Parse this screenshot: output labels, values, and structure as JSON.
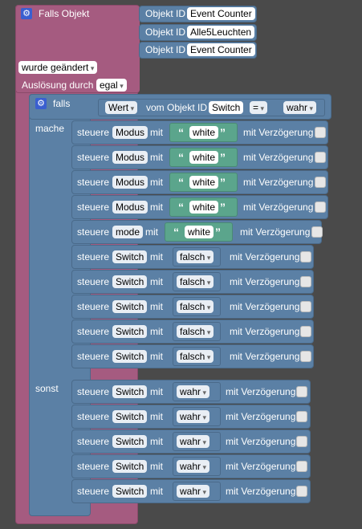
{
  "trigger": {
    "title": "Falls Objekt",
    "objects": [
      {
        "label": "Objekt ID",
        "value": "Event Counter"
      },
      {
        "label": "Objekt ID",
        "value": "Alle5Leuchten"
      },
      {
        "label": "Objekt ID",
        "value": "Event Counter"
      }
    ],
    "condition_value": "wurde geändert",
    "trigger_label": "Auslösung durch",
    "trigger_value": "egal"
  },
  "if_block": {
    "falls_label": "falls",
    "mache_label": "mache",
    "sonst_label": "sonst",
    "cond": {
      "attr": "Wert",
      "of_label": "vom Objekt ID",
      "obj": "Switch",
      "op": "=",
      "value": "wahr"
    }
  },
  "mache_rows": [
    {
      "steuere": "steuere",
      "target": "Modus",
      "mit": "mit",
      "value": "white",
      "delay": "mit Verzögerung"
    },
    {
      "steuere": "steuere",
      "target": "Modus",
      "mit": "mit",
      "value": "white",
      "delay": "mit Verzögerung"
    },
    {
      "steuere": "steuere",
      "target": "Modus",
      "mit": "mit",
      "value": "white",
      "delay": "mit Verzögerung"
    },
    {
      "steuere": "steuere",
      "target": "Modus",
      "mit": "mit",
      "value": "white",
      "delay": "mit Verzögerung"
    },
    {
      "steuere": "steuere",
      "target": "mode",
      "mit": "mit",
      "value": "white",
      "delay": "mit Verzögerung"
    },
    {
      "steuere": "steuere",
      "target": "Switch",
      "mit": "mit",
      "value": "falsch",
      "delay": "mit Verzögerung"
    },
    {
      "steuere": "steuere",
      "target": "Switch",
      "mit": "mit",
      "value": "falsch",
      "delay": "mit Verzögerung"
    },
    {
      "steuere": "steuere",
      "target": "Switch",
      "mit": "mit",
      "value": "falsch",
      "delay": "mit Verzögerung"
    },
    {
      "steuere": "steuere",
      "target": "Switch",
      "mit": "mit",
      "value": "falsch",
      "delay": "mit Verzögerung"
    },
    {
      "steuere": "steuere",
      "target": "Switch",
      "mit": "mit",
      "value": "falsch",
      "delay": "mit Verzögerung"
    }
  ],
  "sonst_rows": [
    {
      "steuere": "steuere",
      "target": "Switch",
      "mit": "mit",
      "value": "wahr",
      "delay": "mit Verzögerung"
    },
    {
      "steuere": "steuere",
      "target": "Switch",
      "mit": "mit",
      "value": "wahr",
      "delay": "mit Verzögerung"
    },
    {
      "steuere": "steuere",
      "target": "Switch",
      "mit": "mit",
      "value": "wahr",
      "delay": "mit Verzögerung"
    },
    {
      "steuere": "steuere",
      "target": "Switch",
      "mit": "mit",
      "value": "wahr",
      "delay": "mit Verzögerung"
    },
    {
      "steuere": "steuere",
      "target": "Switch",
      "mit": "mit",
      "value": "wahr",
      "delay": "mit Verzögerung"
    }
  ],
  "colors": {
    "trigger": "#a55b80",
    "control": "#5b80a5",
    "text": "#5ba58c",
    "canvas": "#4a4a4a"
  },
  "icons": {
    "gear": "gear-icon",
    "quote_open": "“",
    "quote_close": "”"
  }
}
